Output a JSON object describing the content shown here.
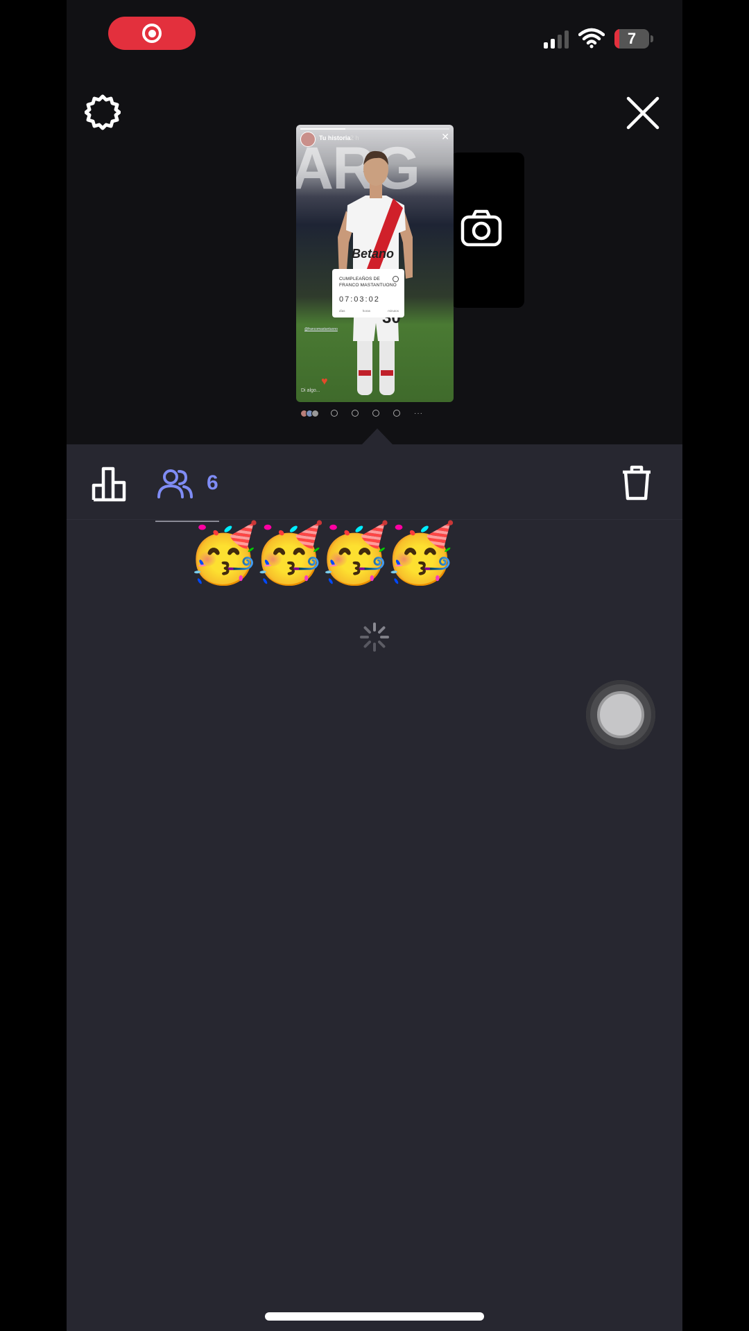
{
  "status_bar": {
    "recording_icon": "screen-record-icon",
    "signal_icon": "cellular-signal-icon",
    "wifi_icon": "wifi-icon",
    "battery_level": "7",
    "colors": {
      "recording": "#e3303d",
      "battery_low": "#e3303d"
    }
  },
  "top_bar": {
    "settings_icon": "gear-icon",
    "close_icon": "close-icon"
  },
  "story_preview": {
    "header_title": "Tu historia",
    "header_time": "2 h",
    "background_text": "ARG",
    "jersey_sponsor": "Betano",
    "jersey_number": "30",
    "countdown": {
      "title_line1": "CUMPLEAÑOS DE",
      "title_line2": "FRANCO MASTANTUONO",
      "digits": "07:03:02",
      "units": [
        "días",
        "horas",
        "minutos"
      ]
    },
    "mention": "@francomastantuono",
    "reply_placeholder": "Di algo..."
  },
  "camera_card": {
    "icon": "camera-icon"
  },
  "panel": {
    "stats_icon": "bar-chart-icon",
    "viewers_icon": "people-icon",
    "viewers_count": "6",
    "trash_icon": "trash-icon",
    "reactions": "🥳🥳🥳🥳",
    "loading_icon": "spinner-icon",
    "accent_color": "#7f8cf5"
  }
}
